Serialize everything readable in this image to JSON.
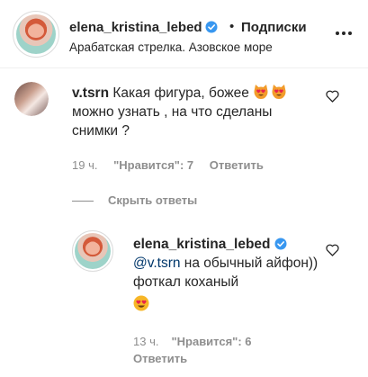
{
  "header": {
    "username": "elena_kristina_lebed",
    "separator": "•",
    "follow_label": "Подписки",
    "location": "Арабатская стрелка. Азовское море"
  },
  "comment": {
    "username": "v.tsrn",
    "text_line1": "Какая фигура, божее",
    "text_rest": "можно узнать , на что сделаны снимки ?",
    "emojis": [
      "heart-eyes-cat-emoji",
      "heart-eyes-cat-emoji"
    ],
    "time": "19 ч.",
    "likes": "\"Нравится\": 7",
    "reply_label": "Ответить"
  },
  "replies_toggle": {
    "label": "Скрыть ответы"
  },
  "reply": {
    "username": "elena_kristina_lebed",
    "mention": "@v.tsrn",
    "text": "на обычный айфон)) фоткал коханый",
    "emoji": "heart-eyes-emoji",
    "time": "13 ч.",
    "likes": "\"Нравится\": 6",
    "reply_label": "Ответить"
  },
  "colors": {
    "text": "#262626",
    "secondary": "#8e8e8e",
    "mention": "#00376b",
    "verified": "#3897f0"
  }
}
